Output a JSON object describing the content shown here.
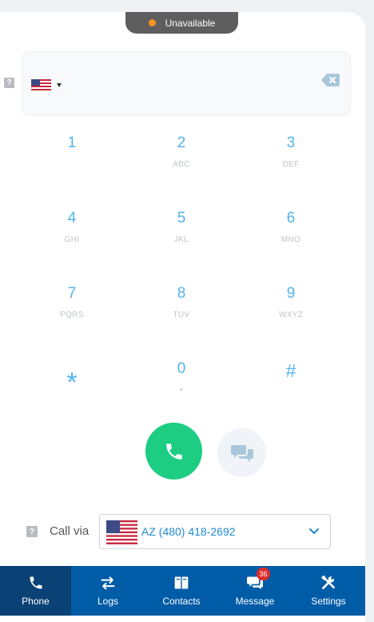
{
  "status": {
    "label": "Unavailable",
    "dot_color": "#f7931e"
  },
  "dialer": {
    "country_flag": "us-flag-icon",
    "input_value": ""
  },
  "keypad": [
    {
      "digit": "1",
      "letters": ""
    },
    {
      "digit": "2",
      "letters": "ABC"
    },
    {
      "digit": "3",
      "letters": "DEF"
    },
    {
      "digit": "4",
      "letters": "GHI"
    },
    {
      "digit": "5",
      "letters": "JKL"
    },
    {
      "digit": "6",
      "letters": "MNO"
    },
    {
      "digit": "7",
      "letters": "PQRS"
    },
    {
      "digit": "8",
      "letters": "TUV"
    },
    {
      "digit": "9",
      "letters": "WXYZ"
    },
    {
      "digit": "*",
      "letters": ""
    },
    {
      "digit": "0",
      "letters": "+"
    },
    {
      "digit": "#",
      "letters": ""
    }
  ],
  "actions": {
    "call_color": "#1ccd82",
    "call_icon": "phone-icon",
    "message_icon": "chat-bubbles-icon"
  },
  "call_via": {
    "label": "Call via",
    "selected": "AZ (480) 418-2692"
  },
  "tabs": [
    {
      "label": "Phone",
      "icon": "phone-icon",
      "active": true
    },
    {
      "label": "Logs",
      "icon": "arrows-icon",
      "active": false
    },
    {
      "label": "Contacts",
      "icon": "address-book-icon",
      "active": false
    },
    {
      "label": "Message",
      "icon": "chat-icon",
      "active": false,
      "badge": "36"
    },
    {
      "label": "Settings",
      "icon": "tools-icon",
      "active": false
    }
  ],
  "colors": {
    "accent": "#52b4ec",
    "tabbar": "#005ca7",
    "tab_active": "#0a4275",
    "badge": "#e02b2b"
  }
}
